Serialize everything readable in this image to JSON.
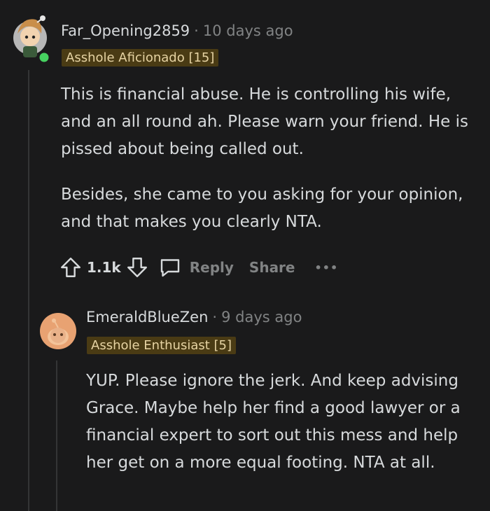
{
  "comments": [
    {
      "username": "Far_Opening2859",
      "age": "10 days ago",
      "flair": "Asshole Aficionado [15]",
      "paragraphs": [
        "This is financial abuse. He is controlling his wife, and an all round ah. Please warn your friend. He is pissed about being called out.",
        "Besides, she came to you asking for your opinion, and that makes you clearly NTA."
      ],
      "score": "1.1k",
      "reply_label": "Reply",
      "share_label": "Share",
      "more_label": "•••"
    },
    {
      "username": "EmeraldBlueZen",
      "age": "9 days ago",
      "flair": "Asshole Enthusiast [5]",
      "paragraphs": [
        "YUP. Please ignore the jerk. And keep advising Grace. Maybe help her find a good lawyer or a financial expert to sort out this mess and help her get on a more equal footing. NTA at all."
      ]
    }
  ],
  "separator": "·",
  "colors": {
    "background": "#1a1a1b",
    "text": "#d7dadc",
    "muted": "#818384",
    "flair_bg": "#4a3b14",
    "online": "#46d160"
  }
}
